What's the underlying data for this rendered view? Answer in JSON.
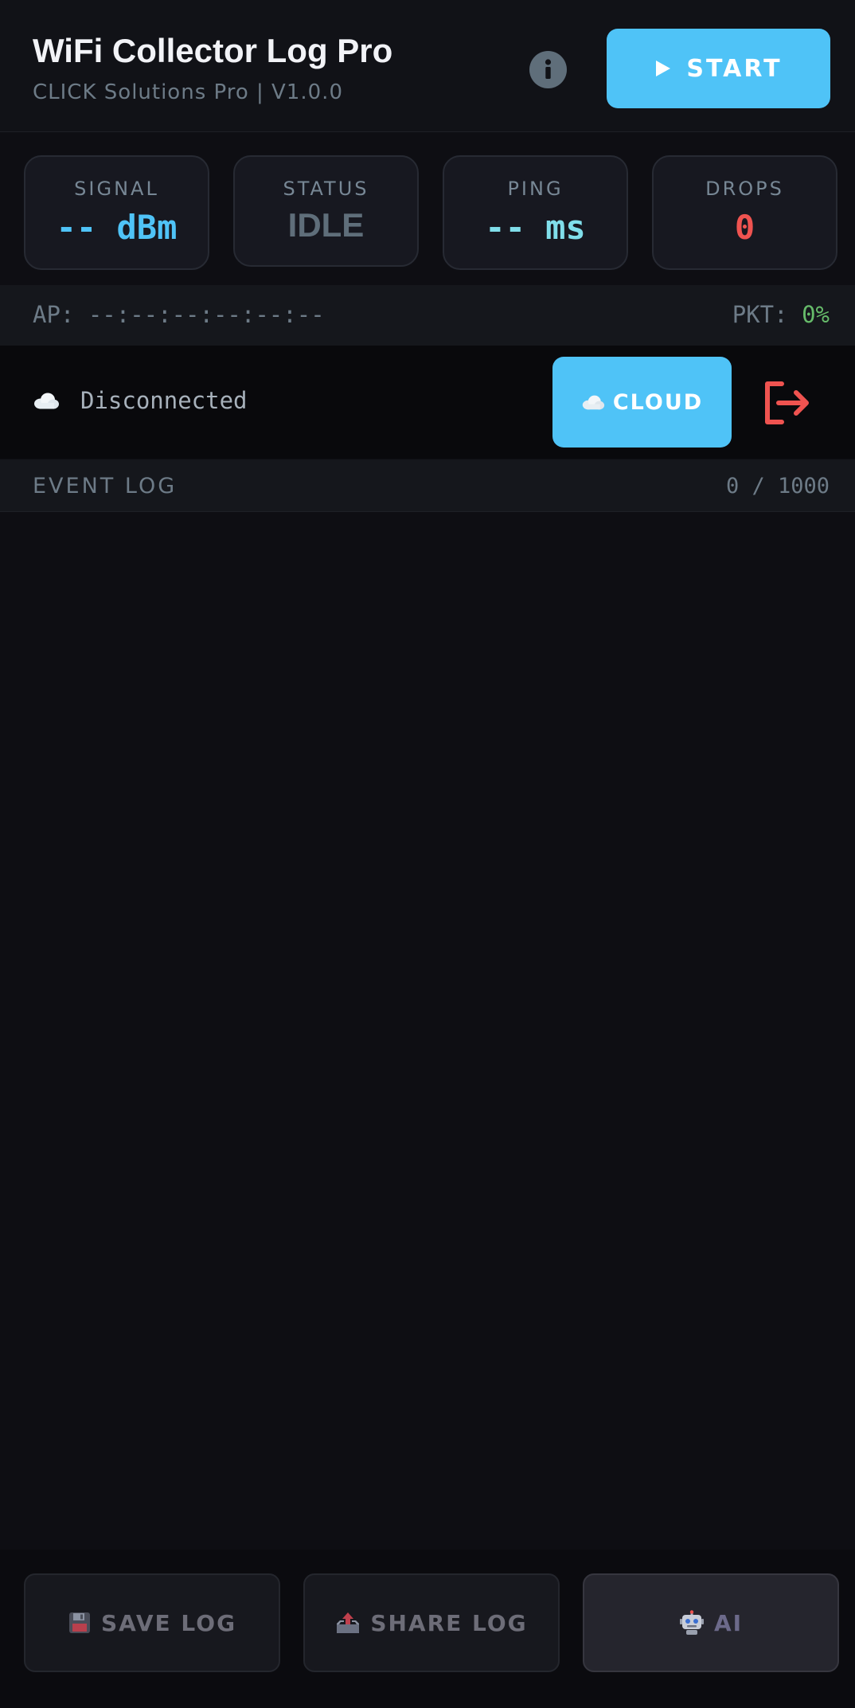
{
  "header": {
    "title": "WiFi Collector Log Pro",
    "subtitle": "CLICK Solutions Pro | V1.0.0",
    "info_icon": "info-icon",
    "start_button": {
      "icon": "play-icon",
      "label": "START"
    }
  },
  "stats": {
    "signal": {
      "label": "SIGNAL",
      "value": "-- dBm",
      "color": "#4fc3f7"
    },
    "status": {
      "label": "STATUS",
      "value": "IDLE",
      "color": "#5f6e7a"
    },
    "ping": {
      "label": "PING",
      "value": "-- ms",
      "color": "#80deea"
    },
    "drops": {
      "label": "DROPS",
      "value": "0",
      "color": "#ef5350"
    }
  },
  "ap_bar": {
    "ap_label": "AP: --:--:--:--:--:--",
    "pkt_prefix": "PKT:",
    "pkt_value": "0%"
  },
  "cloud": {
    "status_icon": "cloud-icon",
    "status_text": "Disconnected",
    "button_label": "CLOUD",
    "logout_icon": "logout-icon"
  },
  "event_log": {
    "title": "EVENT LOG",
    "count": "0 / 1000"
  },
  "bottom_bar": {
    "save": {
      "icon": "floppy-disk-icon",
      "label": "SAVE LOG"
    },
    "share": {
      "icon": "outbox-tray-icon",
      "label": "SHARE LOG"
    },
    "ai": {
      "icon": "robot-icon",
      "label": "AI"
    }
  },
  "colors": {
    "accent": "#4fc3f7",
    "danger": "#ef5350",
    "success": "#66bb6a"
  }
}
